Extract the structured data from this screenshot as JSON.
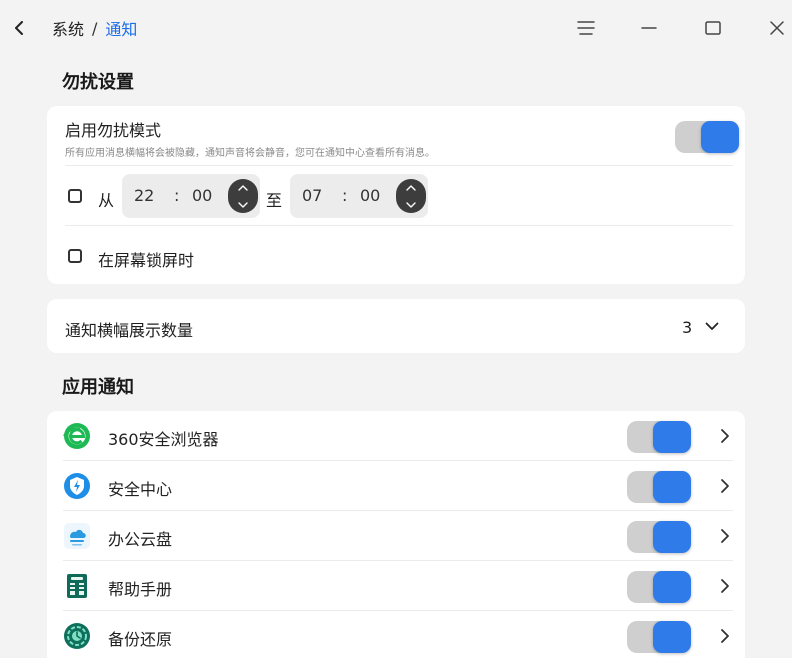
{
  "breadcrumb": {
    "parent": "系统",
    "separator": "/",
    "current": "通知"
  },
  "dnd": {
    "section_title": "勿扰设置",
    "mode_title": "启用勿扰模式",
    "mode_desc": "所有应用消息横幅将会被隐藏，通知声音将会静音，您可在通知中心查看所有消息。",
    "mode_enabled": true,
    "from_label": "从",
    "to_label": "至",
    "start": {
      "hour": "22",
      "colon": ":",
      "minute": "00"
    },
    "end": {
      "hour": "07",
      "colon": ":",
      "minute": "00"
    },
    "schedule_checked": false,
    "lock_label": "在屏幕锁屏时",
    "lock_checked": false
  },
  "banner": {
    "label": "通知横幅展示数量",
    "value": "3"
  },
  "apps": {
    "section_title": "应用通知",
    "items": [
      {
        "name": "360安全浏览器",
        "icon": "browser-360-icon",
        "enabled": true
      },
      {
        "name": "安全中心",
        "icon": "security-center-icon",
        "enabled": true
      },
      {
        "name": "办公云盘",
        "icon": "cloud-disk-icon",
        "enabled": true
      },
      {
        "name": "帮助手册",
        "icon": "help-manual-icon",
        "enabled": true
      },
      {
        "name": "备份还原",
        "icon": "backup-restore-icon",
        "enabled": true
      }
    ]
  },
  "colors": {
    "accent": "#2f7bea",
    "link": "#1c6ee8",
    "background": "#f3f3f3",
    "card": "#ffffff"
  }
}
